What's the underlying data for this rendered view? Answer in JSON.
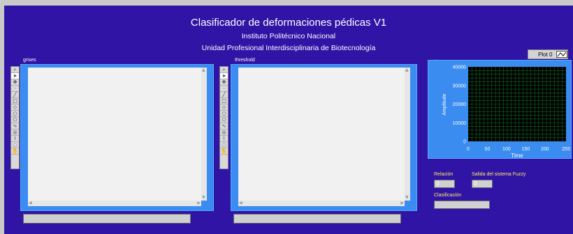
{
  "header": {
    "title": "Clasificador de deformaciones pédicas V1",
    "institution": "Instituto Politécnico Nacional",
    "unit": "Unidad Profesional Interdisciplinaria de Biotecnología"
  },
  "display_grises": {
    "label": "grises"
  },
  "display_threshold": {
    "label": "threshold"
  },
  "tools": [
    "zoom-icon",
    "pointer-icon",
    "pan-icon",
    "point-icon",
    "line-icon",
    "rectangle-icon",
    "rotated-rectangle-icon",
    "oval-icon",
    "polygon-icon",
    "freehand-icon",
    "annulus-icon",
    "broken-line-icon",
    "ring-icon",
    "hand-icon"
  ],
  "histogram": {
    "label": "histograma",
    "plot_legend": "Plot 0",
    "chart_data": {
      "type": "line",
      "title": "",
      "xlabel": "Time",
      "ylabel": "Amplitude",
      "xlim": [
        0,
        255
      ],
      "ylim": [
        0,
        40000
      ],
      "x_ticks": [
        "0",
        "50",
        "100",
        "150",
        "200",
        "255"
      ],
      "y_ticks": [
        "0",
        "10000",
        "20000",
        "30000",
        "40000"
      ],
      "grid": true,
      "background": "#000000",
      "grid_color": "#0e6b23",
      "series": [
        {
          "values": []
        }
      ]
    }
  },
  "outputs": {
    "relacion_label": "Relación",
    "relacion_value": "0",
    "fuzzy_label": "Salida del sistema Fuzzy",
    "fuzzy_value": "0",
    "clasificacion_label": "Clasificación",
    "clasificacion_value": ""
  },
  "colors": {
    "panel": "#2f14a6",
    "frame": "#3a8cf0",
    "label_yellow": "#ffee66"
  }
}
